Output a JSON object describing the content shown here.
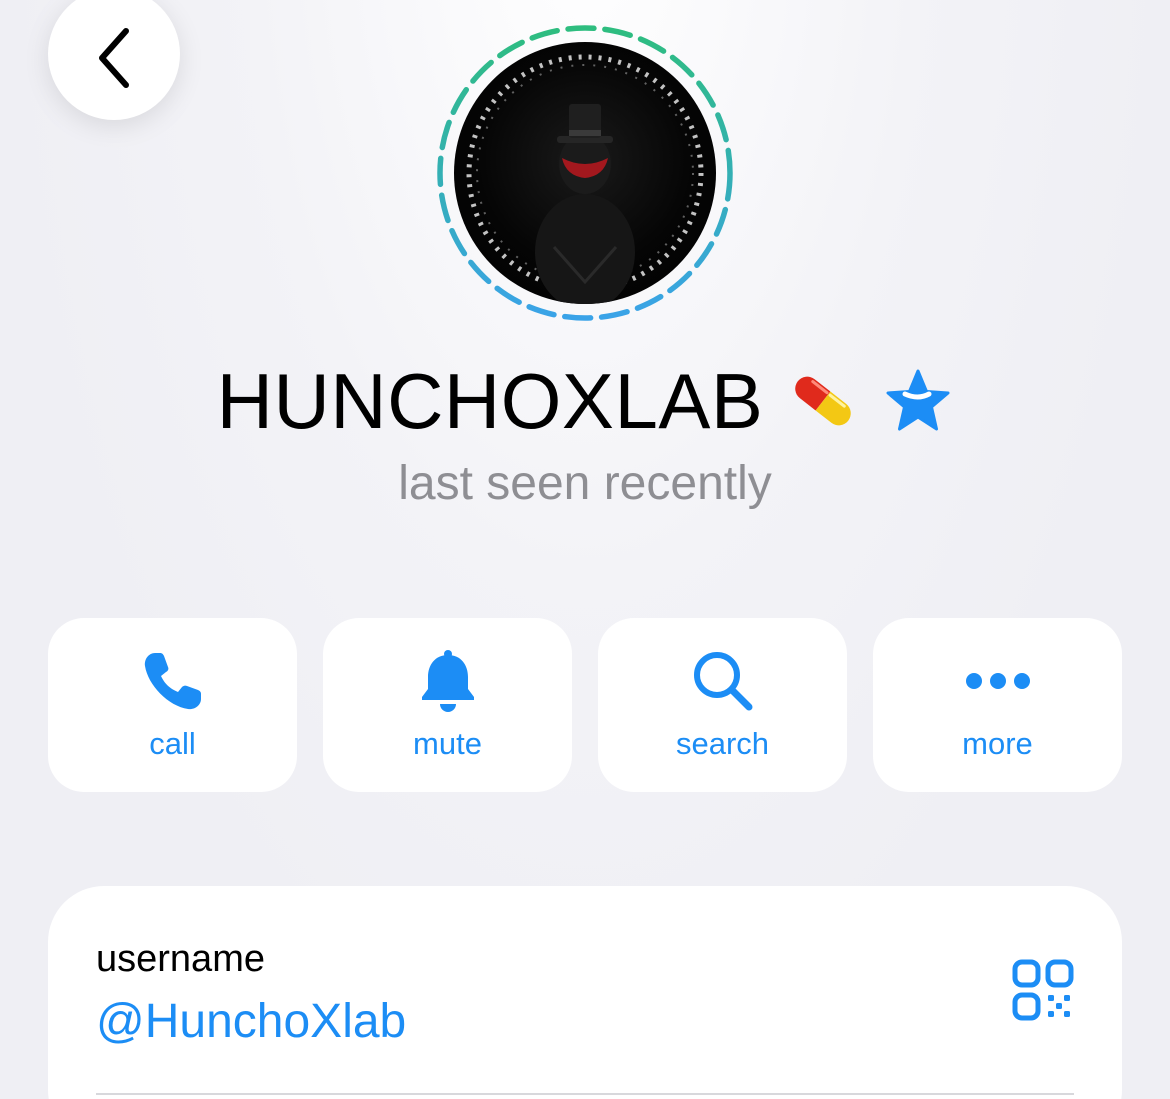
{
  "header": {
    "back_icon": "chevron-left-icon"
  },
  "profile": {
    "name": "HUNCHOXLAB",
    "status": "last seen recently",
    "emoji_icon": "pill-icon",
    "badge_icon": "premium-star-icon"
  },
  "actions": [
    {
      "label": "call",
      "icon": "phone-icon"
    },
    {
      "label": "mute",
      "icon": "bell-icon"
    },
    {
      "label": "search",
      "icon": "search-icon"
    },
    {
      "label": "more",
      "icon": "more-icon"
    }
  ],
  "info": {
    "username_caption": "username",
    "username_value": "@HunchoXlab",
    "qr_icon": "qr-code-icon"
  },
  "colors": {
    "accent": "#1c8df5",
    "background": "#efeff4",
    "story_ring_start": "#2ebd7f",
    "story_ring_end": "#3aa3e8"
  }
}
